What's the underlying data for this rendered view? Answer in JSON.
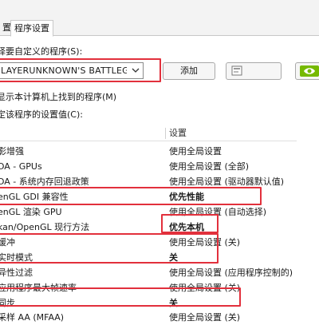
{
  "tabs": {
    "inactive": "置",
    "active": "程序设置"
  },
  "program_label": "择要自定义的程序(S):",
  "program_combo": {
    "value": "LAYERUNKNOWN'S BATTLEGR..."
  },
  "buttons": {
    "add": "添加",
    "delete_icon_mark": "D"
  },
  "show_only_label": "显示本计算机上找到的程序(M)",
  "specify_label": "定该程序的设置值(C):",
  "table": {
    "header_feature": "",
    "header_setting": "设置",
    "rows": [
      {
        "feature": "影增强",
        "setting": "使用全局设置"
      },
      {
        "feature": "DA - GPUs",
        "setting": "使用全局设置 (全部)"
      },
      {
        "feature": "DA - 系统内存回退政策",
        "setting": "使用全局设置 (驱动器默认值)"
      },
      {
        "feature": "enGL GDI 兼容性",
        "setting": "优先性能"
      },
      {
        "feature": "enGL 渲染 GPU",
        "setting": "使用全局设置 (自动选择)"
      },
      {
        "feature": "kan/OpenGL 现行方法",
        "setting": "优先本机"
      },
      {
        "feature": "缓冲",
        "setting": "使用全局设置 (关)"
      },
      {
        "feature": "实时模式",
        "setting": "关"
      },
      {
        "feature": "异性过滤",
        "setting": "使用全局设置 (应用程序控制的)"
      },
      {
        "feature": "应用程序最大帧速率",
        "setting": "使用全局设置 (关)"
      },
      {
        "feature": "同步",
        "setting": "关"
      },
      {
        "feature": "采样 AA (MFAA)",
        "setting": "使用全局设置 (关)"
      }
    ]
  },
  "colors": {
    "annotation": "#e2303c",
    "nvidia_green": "#76b900"
  }
}
